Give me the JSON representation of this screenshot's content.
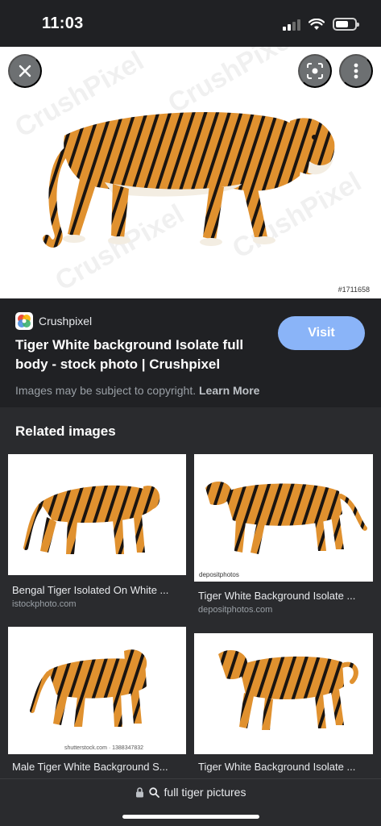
{
  "status": {
    "time": "11:03"
  },
  "hero": {
    "image_label": "Tiger White background Isolate full body",
    "image_id": "#1711658",
    "watermark_text": "CrushPixel"
  },
  "result": {
    "source": "Crushpixel",
    "title": "Tiger White background Isolate full body - stock photo | Crushpixel",
    "visit_label": "Visit",
    "copyright_text": "Images may be subject to copyright.",
    "learn_more_label": "Learn More"
  },
  "related": {
    "heading": "Related images",
    "items": [
      {
        "caption": "Bengal Tiger Isolated On White ...",
        "domain": "istockphoto.com"
      },
      {
        "caption": "Tiger White Background Isolate ...",
        "domain": "depositphotos.com",
        "stamp": "depositphotos"
      },
      {
        "caption": "Male Tiger White Background S...",
        "domain": "",
        "stamp": "shutterstock.com · 1388347832"
      },
      {
        "caption": "Tiger White Background Isolate ...",
        "domain": ""
      }
    ]
  },
  "bottom": {
    "query": "full tiger pictures"
  },
  "colors": {
    "background": "#202124",
    "panel": "#2a2b2e",
    "visit_button": "#8ab4f8",
    "tiger_orange": "#e0912f"
  }
}
